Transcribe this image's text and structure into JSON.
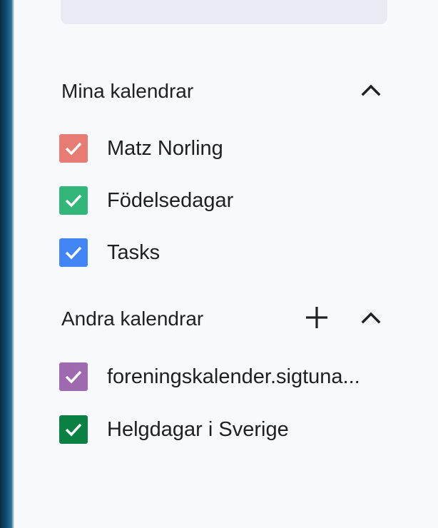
{
  "search": {
    "placeholder": ""
  },
  "my_calendars": {
    "title": "Mina kalendrar",
    "collapse_icon": "chevron-up-icon",
    "items": [
      {
        "label": "Matz Norling",
        "color": "#e67c73",
        "checked": true
      },
      {
        "label": "Födelsedagar",
        "color": "#33b679",
        "checked": true
      },
      {
        "label": "Tasks",
        "color": "#4285f4",
        "checked": true
      }
    ]
  },
  "other_calendars": {
    "title": "Andra kalendrar",
    "add_icon": "plus-icon",
    "collapse_icon": "chevron-up-icon",
    "items": [
      {
        "label": "foreningskalender.sigtuna...",
        "color": "#9e69af",
        "checked": true
      },
      {
        "label": "Helgdagar i Sverige",
        "color": "#0b8043",
        "checked": true
      }
    ]
  }
}
